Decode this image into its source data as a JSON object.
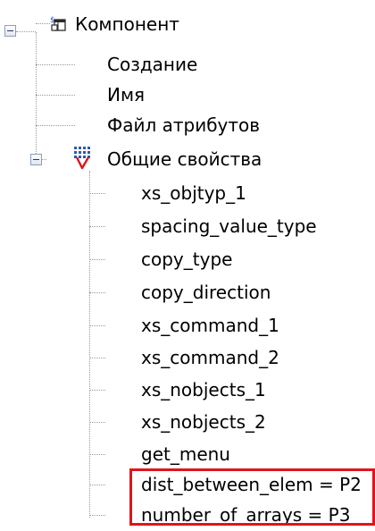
{
  "tree": {
    "root": {
      "label": "Компонент",
      "expanded": true,
      "children": [
        {
          "label": "Создание"
        },
        {
          "label": "Имя"
        },
        {
          "label": "Файл атрибутов"
        },
        {
          "label": "Общие свойства",
          "expanded": true,
          "children": [
            {
              "label": "xs_objtyp_1"
            },
            {
              "label": "spacing_value_type"
            },
            {
              "label": "copy_type"
            },
            {
              "label": "copy_direction"
            },
            {
              "label": "xs_command_1"
            },
            {
              "label": "xs_command_2"
            },
            {
              "label": "xs_nobjects_1"
            },
            {
              "label": "xs_nobjects_2"
            },
            {
              "label": "get_menu"
            },
            {
              "label": "dist_between_elem = P2"
            },
            {
              "label": "number_of_arrays = P3"
            }
          ]
        }
      ]
    }
  },
  "icons": {
    "root": "component-icon",
    "group": "general-properties-icon"
  },
  "colors": {
    "highlight_border": "#e0141c",
    "tree_line": "#9a9a9a"
  }
}
